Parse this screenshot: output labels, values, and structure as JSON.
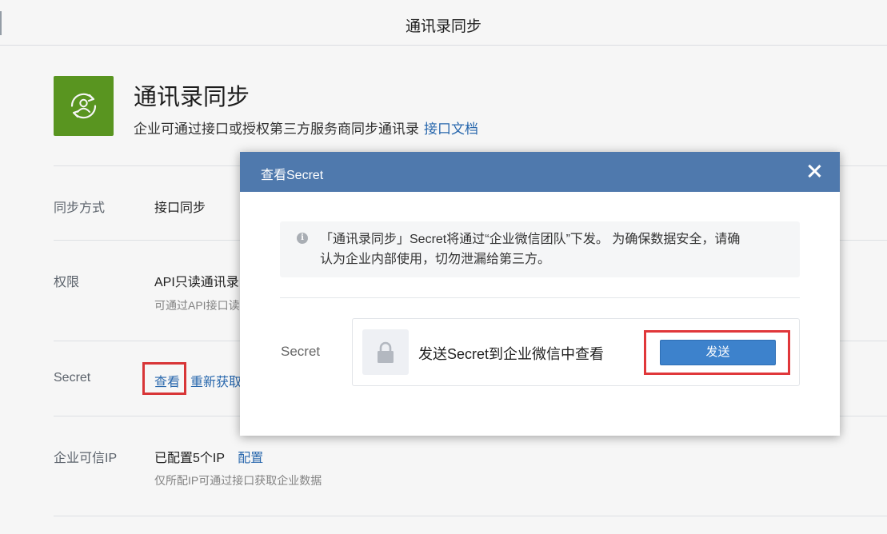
{
  "header": {
    "title": "通讯录同步"
  },
  "app": {
    "title": "通讯录同步",
    "description": "企业可通过接口或授权第三方服务商同步通讯录",
    "doc_link": "接口文档",
    "icon": "sync-contacts-icon",
    "icon_color": "#5d9b22"
  },
  "settings": {
    "sync_mode": {
      "label": "同步方式",
      "value": "接口同步"
    },
    "permission": {
      "label": "权限",
      "value": "API只读通讯录",
      "note": "可通过API接口读"
    },
    "secret": {
      "label": "Secret",
      "view_link": "查看",
      "refetch_link": "重新获取"
    },
    "trusted_ip": {
      "label": "企业可信IP",
      "value": "已配置5个IP",
      "config_link": "配置",
      "note": "仅所配IP可通过接口获取企业数据"
    }
  },
  "modal": {
    "title": "查看Secret",
    "header_color": "#4f79ad",
    "notice_line1": "「通讯录同步」Secret将通过“企业微信团队”下发。 为确保数据安全，请确",
    "notice_line2": "认为企业内部使用，切勿泄漏给第三方。",
    "secret_label": "Secret",
    "send_text": "发送Secret到企业微信中查看",
    "send_button": "发送",
    "button_color": "#3d82cc",
    "highlight_color": "#e0373a"
  }
}
